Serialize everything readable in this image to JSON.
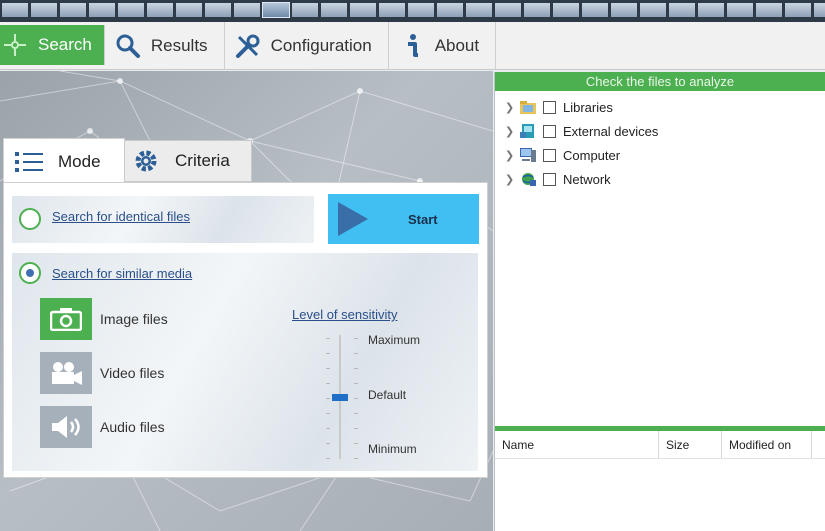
{
  "menu": {
    "items": [
      {
        "label": "Search",
        "icon": "crosshair-icon",
        "active": true
      },
      {
        "label": "Results",
        "icon": "magnifier-icon",
        "active": false
      },
      {
        "label": "Configuration",
        "icon": "tools-icon",
        "active": false
      },
      {
        "label": "About",
        "icon": "info-icon",
        "active": false
      }
    ]
  },
  "tabs": {
    "mode": "Mode",
    "criteria": "Criteria"
  },
  "mode_panel": {
    "identical_label": "Search for identical files",
    "similar_label": "Search for similar media",
    "start_label": "Start",
    "media": [
      {
        "label": "Image files",
        "icon": "camera-icon",
        "active": true
      },
      {
        "label": "Video files",
        "icon": "video-camera-icon",
        "active": false
      },
      {
        "label": "Audio files",
        "icon": "speaker-icon",
        "active": false
      }
    ],
    "sensitivity": {
      "title": "Level of sensitivity",
      "max_label": "Maximum",
      "default_label": "Default",
      "min_label": "Minimum",
      "level": 0.5
    }
  },
  "files_panel": {
    "header": "Check the files to analyze",
    "tree": [
      {
        "label": "Libraries",
        "icon": "libraries-icon"
      },
      {
        "label": "External devices",
        "icon": "external-devices-icon"
      },
      {
        "label": "Computer",
        "icon": "computer-icon"
      },
      {
        "label": "Network",
        "icon": "network-icon"
      }
    ],
    "columns": [
      "Name",
      "Size",
      "Modified on"
    ]
  },
  "colors": {
    "accent_green": "#4caf50",
    "start_blue": "#3fbff2",
    "slider_blue": "#1f6fc8"
  }
}
